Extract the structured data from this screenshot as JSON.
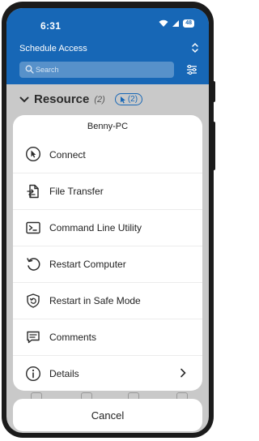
{
  "status_bar": {
    "time": "6:31",
    "battery": "48"
  },
  "header": {
    "title": "Schedule Access"
  },
  "search": {
    "placeholder": "Search"
  },
  "section": {
    "title": "Resource",
    "count": "(2)",
    "selected_count": "(2)"
  },
  "sheet": {
    "title": "Benny-PC",
    "items": [
      {
        "label": "Connect",
        "icon": "cursor-icon"
      },
      {
        "label": "File Transfer",
        "icon": "file-transfer-icon"
      },
      {
        "label": "Command Line Utility",
        "icon": "terminal-icon"
      },
      {
        "label": "Restart Computer",
        "icon": "restart-icon"
      },
      {
        "label": "Restart in Safe Mode",
        "icon": "shield-restart-icon"
      },
      {
        "label": "Comments",
        "icon": "comment-icon"
      },
      {
        "label": "Details",
        "icon": "info-icon"
      }
    ]
  },
  "cancel_label": "Cancel",
  "colors": {
    "header_blue": "#1767b6",
    "dim_overlay": "#c9c9c9"
  }
}
